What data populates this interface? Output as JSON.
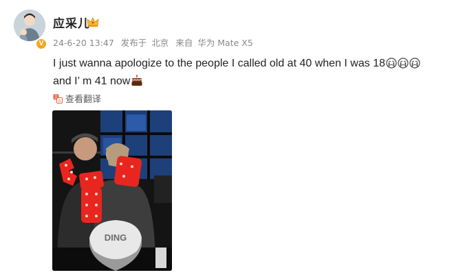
{
  "post": {
    "username": "应采儿",
    "timestamp": "24-6-20 13:47",
    "posted_via_label": "发布于",
    "location": "北京",
    "from_label": "来自",
    "device": "华为 Mate X5",
    "text_line1": "I just wanna apologize to the people I called old at 40 when I was 18",
    "text_line2": "and I’ m 41 now",
    "translate_label": "查看翻译",
    "verified_badge": "V"
  },
  "icons": {
    "crown": "crown-icon",
    "cry": "crying-face-emoji",
    "cake": "cake-emoji",
    "translate": "translate-icon"
  },
  "photo": {
    "cake_text": "DING"
  },
  "colors": {
    "accent": "#f5a623",
    "meta_text": "#888888",
    "marquee_red": "#e8261f"
  }
}
